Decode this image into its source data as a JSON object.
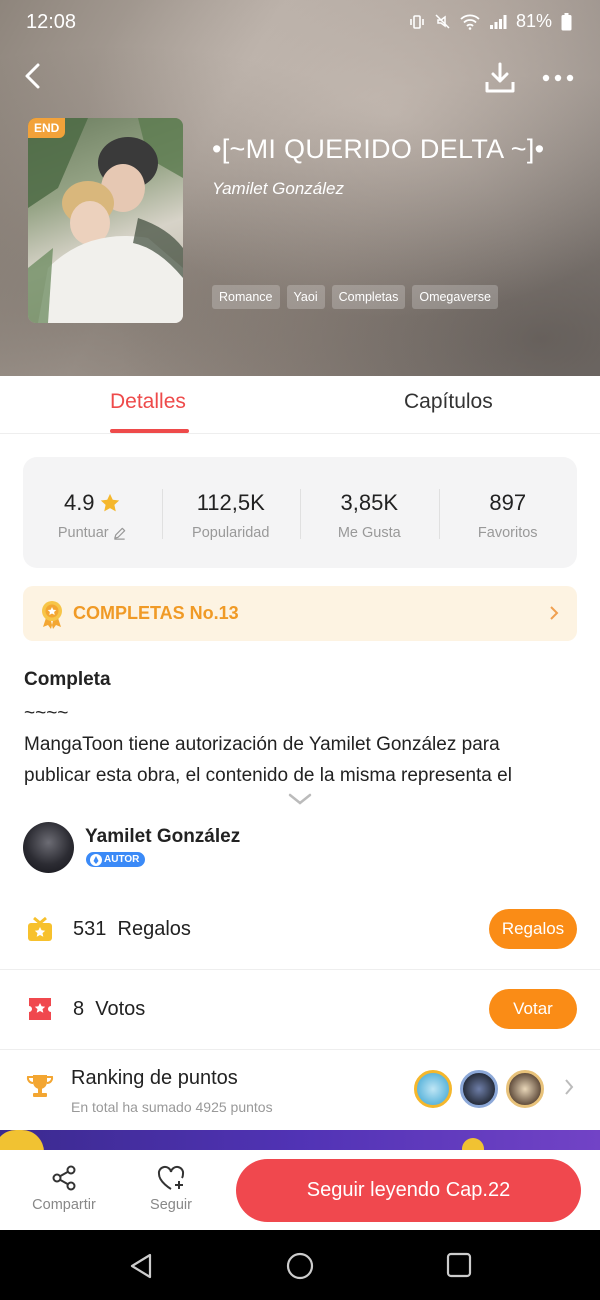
{
  "status_bar": {
    "time": "12:08",
    "battery": "81%"
  },
  "header": {
    "badge": "END",
    "title": "•[~MI QUERIDO DELTA ~]•",
    "author": "Yamilet González",
    "tags": [
      "Romance",
      "Yaoi",
      "Completas",
      "Omegaverse"
    ]
  },
  "tabs": {
    "details": "Detalles",
    "chapters": "Capítulos"
  },
  "stats": [
    {
      "value": "4.9",
      "label": "Puntuar"
    },
    {
      "value": "112,5K",
      "label": "Popularidad"
    },
    {
      "value": "3,85K",
      "label": "Me Gusta"
    },
    {
      "value": "897",
      "label": "Favoritos"
    }
  ],
  "rank_banner": {
    "text": "COMPLETAS No.13"
  },
  "description": {
    "heading": "Completa",
    "line1": "~~~~",
    "line2": "MangaToon tiene autorización de Yamilet González para",
    "line3": "publicar esta obra, el contenido de la misma representa el"
  },
  "author_row": {
    "name": "Yamilet González",
    "badge": "AUTOR"
  },
  "gifts": {
    "count": "531",
    "label": "Regalos",
    "button": "Regalos"
  },
  "votes": {
    "count": "8",
    "label": "Votos",
    "button": "Votar"
  },
  "ranking": {
    "title": "Ranking de puntos",
    "subtitle": "En total ha sumado 4925 puntos"
  },
  "bottom_bar": {
    "share": "Compartir",
    "follow": "Seguir",
    "read_button": "Seguir leyendo Cap.22"
  },
  "colors": {
    "accent": "#ee4a4a",
    "orange": "#fa8c16",
    "gold": "#f09a26"
  }
}
